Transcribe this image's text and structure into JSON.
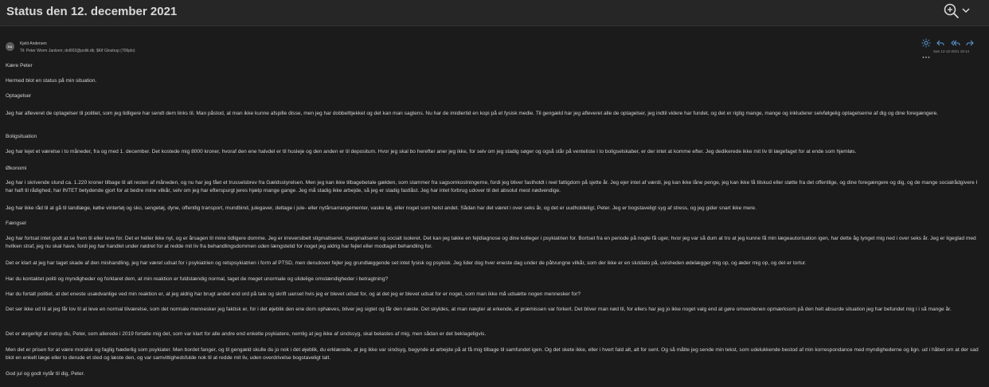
{
  "header": {
    "title": "Status den 12. december 2021"
  },
  "icons": {
    "zoom": "zoom-in-icon",
    "chevron": "chevron-down-icon",
    "avatar_initials": "KA"
  },
  "email": {
    "sender": "Kjeld Andersen",
    "recipients": "Til: Peter Worm Jantzen; dol002@politi.dk; $Kif Glostrup (706plo)",
    "datetime": "Søn 12-12-2021 18:14",
    "paragraphs": [
      "Kære Peter",
      "Hermed blot en status på min situation.",
      "Optagelser",
      "Jeg har afleveret de optagelser til politiet, som jeg tidligere har sendt dem links til. Man påstod, at man ikke kunne afspille disse, men jeg har dobbelttjekket og det kan man sagtens. Nu har de imidlertid en kopi på et fysisk medie. Til gengæld har jeg afleveret alle de optagelser, jeg indtil videre har fundet, og det er rigtig mange, mange og inkluderer selvfølgelig optagelserne af dig og dine foregængere.",
      "Boligsituation",
      "Jeg har lejet et værelse i to måneder, fra og med 1. december. Det kostede mig 8000 kroner, hvoraf den ene halvdel er til husleje og den anden er til depositum. Hvor jeg skal bo herefter aner jeg ikke, for selv om jeg stadig søger og også står på venteliste i to boligselskaber, er der intet at komme efter. Jeg dedikerede ikke mit liv til lægefaget for at ende som hjemløs.",
      "Økonomi",
      "Jeg har i skrivende stund ca. 1.220 kroner tilbage til alt resten af måneden, og nu har jeg fået et trusselsbrev fra Gældsstyrelsen. Men jeg kan ikke tilbagebetale gælden, som stammer fra sagsomkostningerne, fordi jeg bliver fastholdt i reel fattigdom på sjette år. Jeg ejer intet af værdi, jeg kan ikke låne penge, jeg kan ikke få tilskud eller støtte fra det offentlige, og dine foregængere og dig, og de mange socialrådgivere I har haft til rådighed, har INTET betydende gjort for at bedre mine vilkår, selv om jeg har efterspurgt jeres hjælp mange gange. Jeg må stadig ikke arbejde, så jeg er stadig fastlåst. Jeg har intet forbrug udover til det absolut mest nødvendige.",
      "Jeg har ikke råd til at gå til tandlæge, købe vintertøj og sko, sengetøj, dyne, offentlig transport, mundbind, julegaver, deltage i jule- eller nytårsarrangementer, vaske tøj, eller noget som helst andet. Sådan har det været i over seks år, og det er uudholdeligt, Peter. Jeg er bogstaveligt syg af stress, og jeg gider snart ikke mere.",
      "Fængsel",
      "Jeg har fortsat intet godt at se frem til eller leve for. Det er heller ikke nyt, og er årsagen til mine tidligere domme. Jeg er irreversibelt stigmatiseret, marginaliseret og socialt isoleret. Det kan jeg takke en fejldiagnose og dine kolleger i psykiatrien for. Bortset fra en periode på nogle få uger, hvor jeg var så dum at tro at jeg kunne få min lægeautorisation igen, har dette åg tynget mig ned i over seks år. Jeg er ligeglad med hvilken straf, jeg nu skal have, fordi jeg har handlet under nødret for at redde mit liv fra behandlingsdommen uden længstetid for noget jeg aldrig har fejlet eller modtaget behandling for.",
      "Det er klart at jeg har taget skade af den mishandling, jeg har været udsat for i psykiatrien og retspsykiatrien i form af PTSD, men derudover fejler jeg grundlæggende set intet fysisk og psykisk. Jeg lider dog hver eneste dag under de påtvungne vilkår, som der ikke er en slutdato på, uvisheden ødelægger mig op, og æder mig op, og det er tortur.",
      "Har du kontaktet politi og myndigheder og forklaret dem, at min reaktion er fuldstændig normal, taget de meget unormale og ulidelige omstændigheder i betragtning?",
      "Har du fortalt politiet, at det eneste usædvanlige ved min reaktion er, at jeg aldrig har brugt andet end ord på tale og skrift uanset hvis jeg er blevet udsat for, og at det jeg er blevet udsat for er noget, som man ikke må udsætte nogen mennesker for?",
      "Det ser ikke ud til at jeg får lov til at leve en normal tilværelse, som det normale mennesker jeg faktisk er, for i det øjeblik den ene dom ophæves, bliver jeg sigtet og får den næste. Det skyldes, at man nægter at erkende, at præmissen var forkert. Det bliver man nød til, for ellers har jeg jo ikke noget valg end at gøre omverdenen opmærksom på den helt absurde situation jeg har befundet mig i i så mange år.",
      "Det er ærgerligt at netop du, Peter, som allerede i 2019 fortalte mig det, som var klart for alle andre end enkelte psykiatere, nemlig at jeg ikke af sindssyg, skal belastes af mig, men sådan er det beklageligvis.",
      "Men det er prisen for at være moralsk og faglig hæderlig som psykiater. Men bordet fanger, og til gengæld skulle du jo nok i det øjeblik, du erklærede, at jeg ikke var sindsyg, begynde at arbejde på at få mig tilbage til samfundet igen. Og det skete ikke, eller i hvert fald alt, alt for sent. Og så måtte jeg sende min tekst, som udelukkende bestod af min korrespondance med myndighederne og lign. ud i håbet om at der sad blot en enkelt læge eller to derude et sted og læste den, og var samvittighedsfulde nok til at redde mit liv, uden overdrivelse bogstaveligt talt.",
      "God jul og godt nytår til dig, Peter."
    ]
  }
}
